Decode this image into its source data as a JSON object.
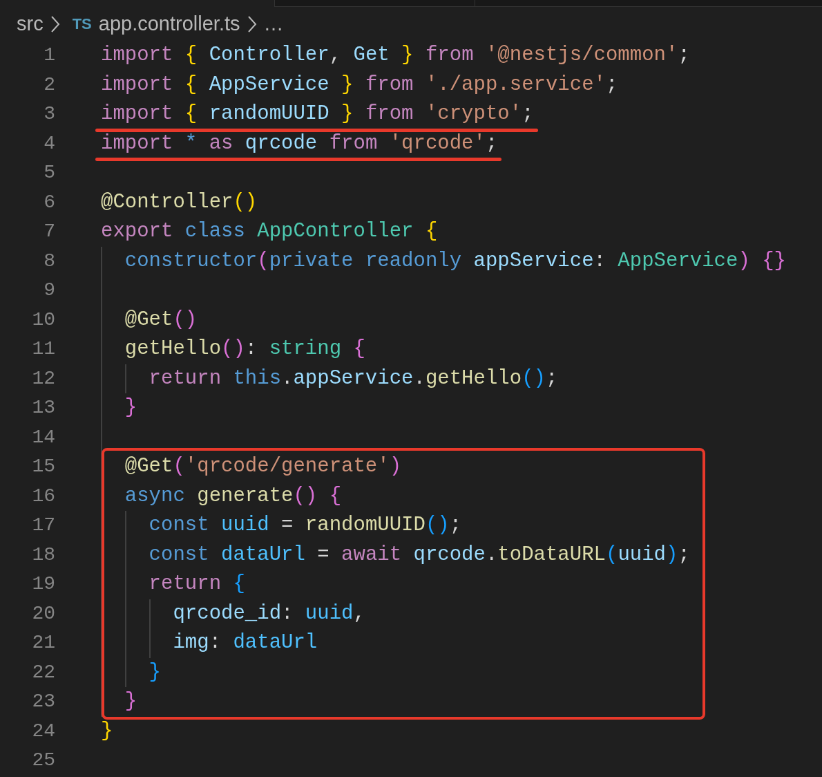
{
  "breadcrumb": {
    "folder": "src",
    "file_badge": "TS",
    "file": "app.controller.ts",
    "more": "…"
  },
  "blocks": [
    {
      "boxed": false,
      "lines": [
        {
          "number": "1",
          "underlined": false,
          "tokens": [
            {
              "kind": "keyword",
              "text": "import"
            },
            {
              "kind": "bracket1",
              "text": " {"
            },
            {
              "kind": "variable",
              "text": " Controller"
            },
            {
              "kind": "punctuation",
              "text": ","
            },
            {
              "kind": "variable",
              "text": " Get"
            },
            {
              "kind": "bracket1",
              "text": " }"
            },
            {
              "kind": "keyword",
              "text": " from"
            },
            {
              "kind": "string",
              "text": " '@nestjs/common'"
            },
            {
              "kind": "punctuation",
              "text": ";"
            }
          ]
        },
        {
          "number": "2",
          "underlined": false,
          "tokens": [
            {
              "kind": "keyword",
              "text": "import"
            },
            {
              "kind": "bracket1",
              "text": " {"
            },
            {
              "kind": "variable",
              "text": " AppService"
            },
            {
              "kind": "bracket1",
              "text": " }"
            },
            {
              "kind": "keyword",
              "text": " from"
            },
            {
              "kind": "string",
              "text": " './app.service'"
            },
            {
              "kind": "punctuation",
              "text": ";"
            }
          ]
        },
        {
          "number": "3",
          "underlined": true,
          "tokens": [
            {
              "kind": "keyword",
              "text": "import"
            },
            {
              "kind": "bracket1",
              "text": " {"
            },
            {
              "kind": "variable",
              "text": " randomUUID"
            },
            {
              "kind": "bracket1",
              "text": " }"
            },
            {
              "kind": "keyword",
              "text": " from"
            },
            {
              "kind": "string",
              "text": " 'crypto'"
            },
            {
              "kind": "punctuation",
              "text": ";"
            }
          ]
        },
        {
          "number": "4",
          "underlined": true,
          "tokens": [
            {
              "kind": "keyword",
              "text": "import"
            },
            {
              "kind": "storage",
              "text": " *"
            },
            {
              "kind": "keyword",
              "text": " as"
            },
            {
              "kind": "variable",
              "text": " qrcode"
            },
            {
              "kind": "keyword",
              "text": " from"
            },
            {
              "kind": "string",
              "text": " 'qrcode'"
            },
            {
              "kind": "punctuation",
              "text": ";"
            }
          ]
        },
        {
          "number": "5"
        },
        {
          "number": "6",
          "underlined": false,
          "tokens": [
            {
              "kind": "function",
              "text": "@Controller"
            },
            {
              "kind": "bracket1",
              "text": "()"
            }
          ]
        },
        {
          "number": "7",
          "underlined": false,
          "tokens": [
            {
              "kind": "keyword",
              "text": "export"
            },
            {
              "kind": "storage",
              "text": " class"
            },
            {
              "kind": "type",
              "text": " AppController"
            },
            {
              "kind": "bracket1",
              "text": " {"
            }
          ]
        },
        {
          "number": "8",
          "underlined": false,
          "tokens": [
            {
              "kind": "storage",
              "text": "  constructor"
            },
            {
              "kind": "bracket2",
              "text": "("
            },
            {
              "kind": "storage",
              "text": "private"
            },
            {
              "kind": "storage",
              "text": " readonly"
            },
            {
              "kind": "variable",
              "text": " appService"
            },
            {
              "kind": "punctuation",
              "text": ":"
            },
            {
              "kind": "type",
              "text": " AppService"
            },
            {
              "kind": "bracket2",
              "text": ")"
            },
            {
              "kind": "bracket2",
              "text": " {}"
            }
          ]
        },
        {
          "number": "9"
        },
        {
          "number": "10",
          "underlined": false,
          "tokens": [
            {
              "kind": "function",
              "text": "  @Get"
            },
            {
              "kind": "bracket2",
              "text": "()"
            }
          ]
        },
        {
          "number": "11",
          "underlined": false,
          "tokens": [
            {
              "kind": "function",
              "text": "  getHello"
            },
            {
              "kind": "bracket2",
              "text": "()"
            },
            {
              "kind": "punctuation",
              "text": ":"
            },
            {
              "kind": "type",
              "text": " string"
            },
            {
              "kind": "bracket2",
              "text": " {"
            }
          ]
        },
        {
          "number": "12",
          "underlined": false,
          "tokens": [
            {
              "kind": "keyword",
              "text": "    return"
            },
            {
              "kind": "storage",
              "text": " this"
            },
            {
              "kind": "punctuation",
              "text": "."
            },
            {
              "kind": "variable",
              "text": "appService"
            },
            {
              "kind": "punctuation",
              "text": "."
            },
            {
              "kind": "function",
              "text": "getHello"
            },
            {
              "kind": "bracket3",
              "text": "()"
            },
            {
              "kind": "punctuation",
              "text": ";"
            }
          ]
        },
        {
          "number": "13",
          "underlined": false,
          "tokens": [
            {
              "kind": "bracket2",
              "text": "  }"
            }
          ]
        },
        {
          "number": "14"
        }
      ]
    },
    {
      "boxed": true,
      "lines": [
        {
          "number": "15",
          "underlined": false,
          "tokens": [
            {
              "kind": "function",
              "text": "  @Get"
            },
            {
              "kind": "bracket2",
              "text": "("
            },
            {
              "kind": "string",
              "text": "'qrcode/generate'"
            },
            {
              "kind": "bracket2",
              "text": ")"
            }
          ]
        },
        {
          "number": "16",
          "underlined": false,
          "tokens": [
            {
              "kind": "storage",
              "text": "  async"
            },
            {
              "kind": "function",
              "text": " generate"
            },
            {
              "kind": "bracket2",
              "text": "()"
            },
            {
              "kind": "bracket2",
              "text": " {"
            }
          ]
        },
        {
          "number": "17",
          "underlined": false,
          "tokens": [
            {
              "kind": "storage",
              "text": "    const"
            },
            {
              "kind": "constant",
              "text": " uuid"
            },
            {
              "kind": "punctuation",
              "text": " ="
            },
            {
              "kind": "function",
              "text": " randomUUID"
            },
            {
              "kind": "bracket3",
              "text": "()"
            },
            {
              "kind": "punctuation",
              "text": ";"
            }
          ]
        },
        {
          "number": "18",
          "underlined": false,
          "tokens": [
            {
              "kind": "storage",
              "text": "    const"
            },
            {
              "kind": "constant",
              "text": " dataUrl"
            },
            {
              "kind": "punctuation",
              "text": " ="
            },
            {
              "kind": "keyword",
              "text": " await"
            },
            {
              "kind": "variable",
              "text": " qrcode"
            },
            {
              "kind": "punctuation",
              "text": "."
            },
            {
              "kind": "function",
              "text": "toDataURL"
            },
            {
              "kind": "bracket3",
              "text": "("
            },
            {
              "kind": "variable",
              "text": "uuid"
            },
            {
              "kind": "bracket3",
              "text": ")"
            },
            {
              "kind": "punctuation",
              "text": ";"
            }
          ]
        },
        {
          "number": "19",
          "underlined": false,
          "tokens": [
            {
              "kind": "keyword",
              "text": "    return"
            },
            {
              "kind": "bracket3",
              "text": " {"
            }
          ]
        },
        {
          "number": "20",
          "underlined": false,
          "tokens": [
            {
              "kind": "variable",
              "text": "      qrcode_id"
            },
            {
              "kind": "punctuation",
              "text": ":"
            },
            {
              "kind": "constant",
              "text": " uuid"
            },
            {
              "kind": "punctuation",
              "text": ","
            }
          ]
        },
        {
          "number": "21",
          "underlined": false,
          "tokens": [
            {
              "kind": "variable",
              "text": "      img"
            },
            {
              "kind": "punctuation",
              "text": ":"
            },
            {
              "kind": "constant",
              "text": " dataUrl"
            }
          ]
        },
        {
          "number": "22",
          "underlined": false,
          "tokens": [
            {
              "kind": "bracket3",
              "text": "    }"
            }
          ]
        },
        {
          "number": "23",
          "underlined": false,
          "tokens": [
            {
              "kind": "bracket2",
              "text": "  }"
            }
          ]
        }
      ]
    },
    {
      "boxed": false,
      "lines": [
        {
          "number": "24",
          "underlined": false,
          "tokens": [
            {
              "kind": "bracket1",
              "text": "}"
            }
          ]
        },
        {
          "number": "25"
        }
      ]
    }
  ]
}
